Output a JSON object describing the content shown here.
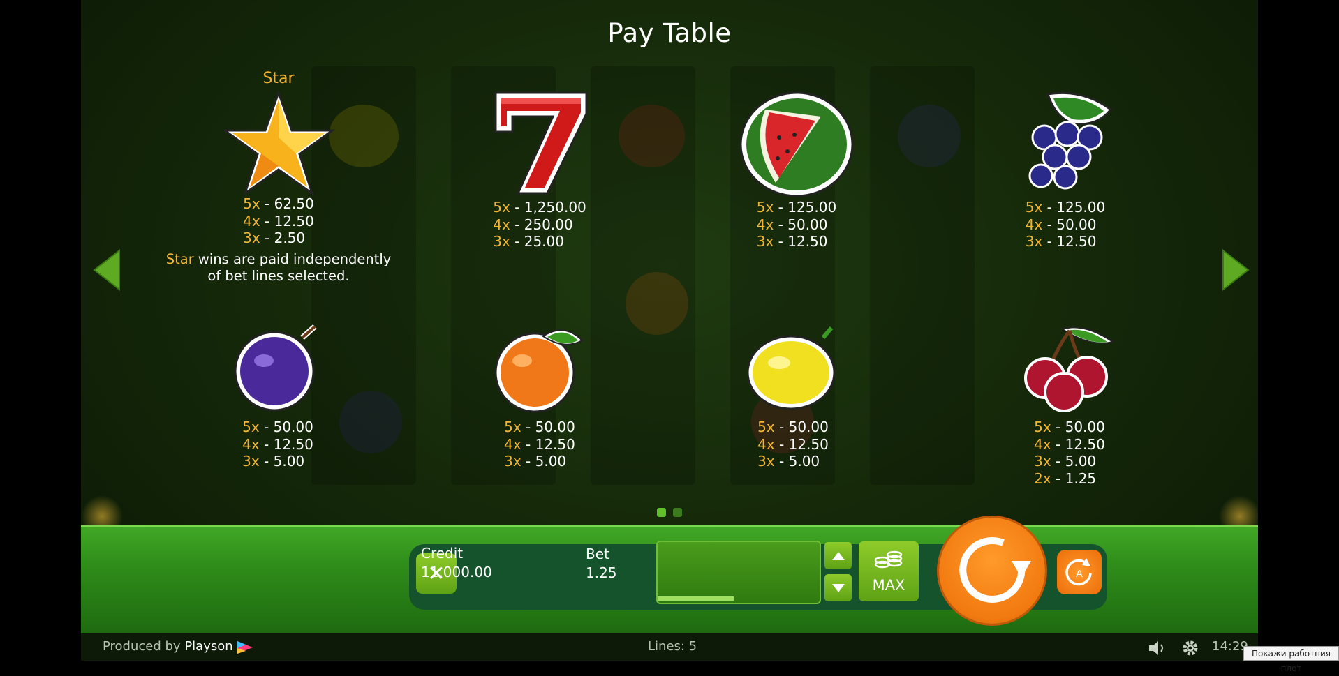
{
  "title": "Pay Table",
  "symbols_row1": [
    {
      "name": "Star",
      "pays": [
        {
          "m": "5x",
          "v": "62.50"
        },
        {
          "m": "4x",
          "v": "12.50"
        },
        {
          "m": "3x",
          "v": "2.50"
        }
      ]
    },
    {
      "name": "",
      "pays": [
        {
          "m": "5x",
          "v": "1,250.00"
        },
        {
          "m": "4x",
          "v": "250.00"
        },
        {
          "m": "3x",
          "v": "25.00"
        }
      ]
    },
    {
      "name": "",
      "pays": [
        {
          "m": "5x",
          "v": "125.00"
        },
        {
          "m": "4x",
          "v": "50.00"
        },
        {
          "m": "3x",
          "v": "12.50"
        }
      ]
    },
    {
      "name": "",
      "pays": [
        {
          "m": "5x",
          "v": "125.00"
        },
        {
          "m": "4x",
          "v": "50.00"
        },
        {
          "m": "3x",
          "v": "12.50"
        }
      ]
    }
  ],
  "symbols_row2": [
    {
      "pays": [
        {
          "m": "5x",
          "v": "50.00"
        },
        {
          "m": "4x",
          "v": "12.50"
        },
        {
          "m": "3x",
          "v": "5.00"
        }
      ]
    },
    {
      "pays": [
        {
          "m": "5x",
          "v": "50.00"
        },
        {
          "m": "4x",
          "v": "12.50"
        },
        {
          "m": "3x",
          "v": "5.00"
        }
      ]
    },
    {
      "pays": [
        {
          "m": "5x",
          "v": "50.00"
        },
        {
          "m": "4x",
          "v": "12.50"
        },
        {
          "m": "3x",
          "v": "5.00"
        }
      ]
    },
    {
      "pays": [
        {
          "m": "5x",
          "v": "50.00"
        },
        {
          "m": "4x",
          "v": "12.50"
        },
        {
          "m": "3x",
          "v": "5.00"
        },
        {
          "m": "2x",
          "v": "1.25"
        }
      ]
    }
  ],
  "star_note": {
    "highlight": "Star",
    "line1": " wins are paid independently",
    "line2": "of bet lines selected."
  },
  "pager": {
    "pages": 2,
    "active": 0
  },
  "controls": {
    "close_symbol": "✕",
    "credit_label": "Credit",
    "credit_value": "11,000.00",
    "bet_label": "Bet",
    "bet_value": "1.25",
    "bet_level_fraction": 0.47,
    "max_label": "MAX"
  },
  "footer": {
    "produced_by": "Produced by",
    "brand": "Playson",
    "lines": "Lines: 5",
    "clock": "14:29"
  },
  "tooltip": "Покажи работния плот",
  "colors": {
    "accent": "#f3b633",
    "green": "#5ea215",
    "orange": "#f27a10"
  }
}
